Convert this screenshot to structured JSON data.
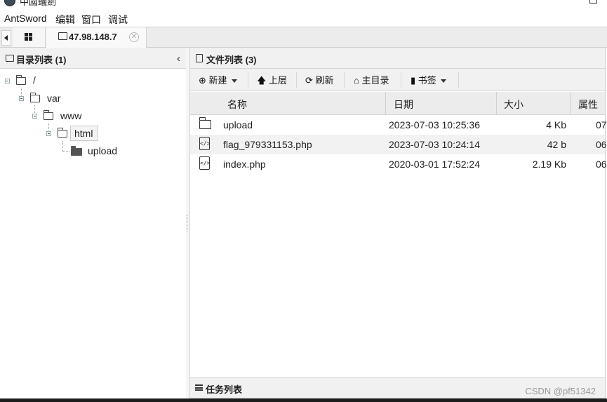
{
  "window": {
    "title": "中國蟻劍"
  },
  "menu": {
    "items": [
      "AntSword",
      "编辑",
      "窗口",
      "调试"
    ]
  },
  "tabs": {
    "host_label": "47.98.148.7",
    "close_glyph": "✕"
  },
  "left_panel": {
    "title": "目录列表 (1)",
    "collapse_glyph": "‹",
    "tree": {
      "root": "/",
      "var": "var",
      "www": "www",
      "html": "html",
      "upload": "upload"
    }
  },
  "right_panel": {
    "title": "文件列表 (3)",
    "toolbar": {
      "new_label": "新建",
      "up_label": "上层",
      "refresh_label": "刷新",
      "home_label": "主目录",
      "bookmark_label": "书签"
    },
    "columns": {
      "name": "名称",
      "date": "日期",
      "size": "大小",
      "attr": "属性"
    },
    "rows": [
      {
        "name": "upload",
        "date": "2023-07-03 10:25:36",
        "size": "4 Kb",
        "attr": "07",
        "type": "folder"
      },
      {
        "name": "flag_979331153.php",
        "date": "2023-07-03 10:24:14",
        "size": "42 b",
        "attr": "06",
        "type": "file"
      },
      {
        "name": "index.php",
        "date": "2020-03-01 17:52:24",
        "size": "2.19 Kb",
        "attr": "06",
        "type": "file"
      }
    ]
  },
  "task_panel": {
    "title": "任务列表"
  },
  "watermark": "CSDN @pf51342",
  "icons": {
    "new": "plus-circle-icon",
    "up": "arrow-up-icon",
    "refresh": "refresh-icon",
    "home": "home-icon",
    "bookmark": "bookmark-icon",
    "file": "code-file-icon",
    "folder": "folder-icon",
    "tasks": "list-icon"
  }
}
